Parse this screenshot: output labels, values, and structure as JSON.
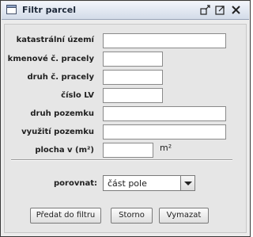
{
  "window": {
    "title": "Filtr parcel",
    "controls": [
      "minimize-icon",
      "maximize-icon",
      "close-icon"
    ]
  },
  "form": {
    "fields": [
      {
        "label": "katastrální území",
        "value": ""
      },
      {
        "label": "kmenové č. pracely",
        "value": ""
      },
      {
        "label": "druh č. pracely",
        "value": ""
      },
      {
        "label": "číslo LV",
        "value": ""
      },
      {
        "label": "druh pozemku",
        "value": ""
      },
      {
        "label": "využití pozemku",
        "value": ""
      },
      {
        "label": "plocha v (m²)",
        "value": "",
        "unit": "m²"
      }
    ],
    "compare": {
      "label": "porovnat:",
      "selected": "část pole"
    }
  },
  "buttons": {
    "submit": "Předat do filtru",
    "cancel": "Storno",
    "clear": "Vymazat"
  },
  "colors": {
    "titlebar": "#d3dbe8",
    "panel": "#e6e6e6",
    "field_bg": "#ffffff"
  }
}
